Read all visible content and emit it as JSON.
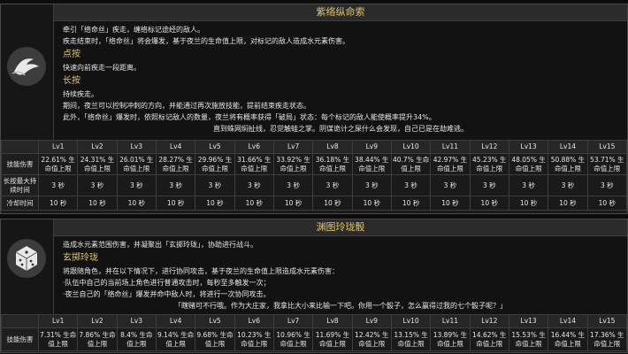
{
  "section1": {
    "title": "紫络纵命索",
    "intro_lines": [
      "牵引「络命丝」疾走，缠络标记途经的敌人。",
      "疾走结束时，「络命丝」将会爆发，基于夜兰的生命值上限，对标记的敌人造成水元素伤害。"
    ],
    "tap_label": "点按",
    "tap_desc": "快速向前疾走一段距离。",
    "hold_label": "长按",
    "hold_lines": [
      "持续疾走。",
      "期间，夜兰可以控制冲刺的方向，并能通过再次施放技能，提前结束疾走状态。",
      "此外，「络命丝」爆发时，依照标记敌人的数量，夜兰将有概率获得「破局」状态：每个标记的敌人能使概率提升34%。"
    ],
    "flavor": "直到蛛网焖扯线，忍觉触蛙之掌。阴谋诡计之屎什么会发现，自己已是在劫难逃。",
    "table": {
      "levels": [
        "Lv1",
        "Lv2",
        "Lv3",
        "Lv4",
        "Lv5",
        "Lv6",
        "Lv7",
        "Lv8",
        "Lv9",
        "Lv10",
        "Lv11",
        "Lv12",
        "Lv13",
        "Lv14",
        "Lv15"
      ],
      "row_damage_label": "技能伤害",
      "damage": [
        "22.61% 生命值上限",
        "24.31% 生命值上限",
        "26.01% 生命值上限",
        "28.27% 生命值上限",
        "29.96% 生命值上限",
        "31.66% 生命值上限",
        "33.92% 生命值上限",
        "36.18% 生命值上限",
        "38.44% 生命值上限",
        "40.7% 生命值上限",
        "42.97% 生命值上限",
        "45.23% 生命值上限",
        "48.05% 生命值上限",
        "50.88% 生命值上限",
        "53.71% 生命值上限"
      ],
      "row_duration_label": "长按最大持续时间",
      "duration": "3 秒",
      "row_cd_label": "冷却时间",
      "cooldown": "10 秒"
    }
  },
  "section2": {
    "title": "渊图玲珑骰",
    "intro": "造成水元素范围伤害，并凝聚出「玄掷玲珑」，协助进行战斗。",
    "sub_label": "玄掷玲珑",
    "lines": [
      "将跟随角色，并在以下情况下，进行协同攻击，基于夜兰的生命值上限造成水元素伤害：",
      "·队伍中自己的当前场上角色进行普通攻击时，每秒至多触发一次；",
      "·夜兰自己的「络命丝」爆发并命中敌人时，将进行一次协同攻击。"
    ],
    "flavor": "「瞎赌可不行哦。作为大庄家，我拿比大小来比输一下吧。你用一个骰子，怎么赢得过我的七个骰子呢？」",
    "table": {
      "levels": [
        "Lv1",
        "Lv2",
        "Lv3",
        "Lv4",
        "Lv5",
        "Lv6",
        "Lv7",
        "Lv8",
        "Lv9",
        "Lv10",
        "Lv11",
        "Lv12",
        "Lv13",
        "Lv14",
        "Lv15"
      ],
      "row_label": "技能伤害",
      "damage": [
        "7.31% 生命值上限",
        "7.86% 生命值上限",
        "8.4% 生命值上限",
        "9.14% 生命值上限",
        "9.68% 生命值上限",
        "10.23% 生命值上限",
        "10.96% 生命值上限",
        "11.69% 生命值上限",
        "12.42% 生命值上限",
        "13.15% 生命值上限",
        "13.89% 生命值上限",
        "14.62% 生命值上限",
        "15.53% 生命值上限",
        "16.44% 生命值上限",
        "17.36% 生命值上限"
      ]
    }
  },
  "colors": {
    "gold": "#e1c46e",
    "bg": "#1b1b1b",
    "border": "#3d3d3d"
  },
  "icons": [
    "lifeline-skill-icon",
    "dice-burst-icon"
  ]
}
